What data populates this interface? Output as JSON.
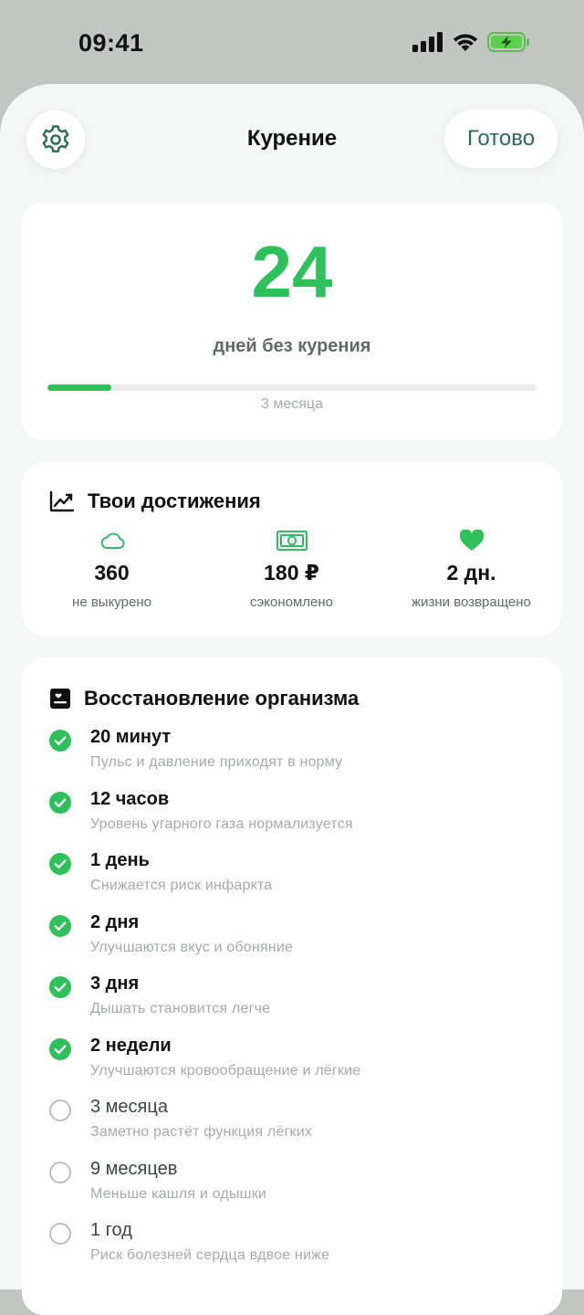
{
  "status": {
    "time": "09:41"
  },
  "nav": {
    "title": "Курение",
    "done_label": "Готово"
  },
  "streak": {
    "days": "24",
    "caption": "дней без курения",
    "goal_label": "3 месяца",
    "progress": 0.13,
    "accent": "#2ec05a"
  },
  "achievements": {
    "title": "Твои достижения",
    "items": [
      {
        "icon": "cloud-icon",
        "value": "360",
        "label": "не выкурено"
      },
      {
        "icon": "banknote-icon",
        "value": "180 ₽",
        "label": "сэкономлено"
      },
      {
        "icon": "heart-icon",
        "value": "2 дн.",
        "label": "жизни возвращено"
      }
    ]
  },
  "recovery": {
    "title": "Восстановление организма",
    "items": [
      {
        "title": "20 минут",
        "subtitle": "Пульс и давление приходят в норму",
        "done": true
      },
      {
        "title": "12 часов",
        "subtitle": "Уровень угарного газа нормализуется",
        "done": true
      },
      {
        "title": "1 день",
        "subtitle": "Снижается риск инфаркта",
        "done": true
      },
      {
        "title": "2 дня",
        "subtitle": "Улучшаются вкус и обоняние",
        "done": true
      },
      {
        "title": "3 дня",
        "subtitle": "Дышать становится легче",
        "done": true
      },
      {
        "title": "2 недели",
        "subtitle": "Улучшаются кровообращение и лёгкие",
        "done": true
      },
      {
        "title": "3 месяца",
        "subtitle": "Заметно растёт функция лёгких",
        "done": false
      },
      {
        "title": "9 месяцев",
        "subtitle": "Меньше кашля и одышки",
        "done": false
      },
      {
        "title": "1 год",
        "subtitle": "Риск болезней сердца вдвое ниже",
        "done": false
      }
    ]
  }
}
